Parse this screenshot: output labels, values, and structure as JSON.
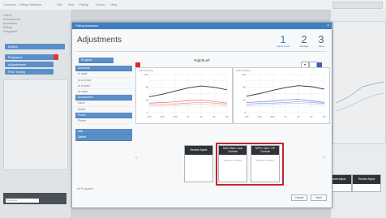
{
  "app": {
    "title": "Connexx - Fitting Software",
    "menu": [
      "File",
      "Edit",
      "Fitting",
      "Extras",
      "Help"
    ],
    "left_list": [
      "Client",
      "Instruments",
      "Acoustics",
      "Fitting",
      "Programs"
    ],
    "left_buttons": [
      "Detect",
      "Programs",
      "Adjustments",
      "Fine Tuning"
    ],
    "bottom_field": "Programs",
    "right_tiles": [
      "Remote Adjust",
      "Remote Adjust"
    ]
  },
  "dialog": {
    "title_bar": "Fitting Assistant",
    "heading": "Adjustments",
    "steps": [
      {
        "num": "1",
        "label": "Adjustments"
      },
      {
        "num": "2",
        "label": "Manage"
      },
      {
        "num": "3",
        "label": "Save"
      }
    ],
    "nav": {
      "top_button": "Program",
      "groups": [
        {
          "header": "Universal",
          "items": [
            "In quiet",
            "In a crowd",
            "In a band",
            "In noise"
          ]
        },
        {
          "header": "Accessories",
          "items": [
            "Hand",
            "Music"
          ]
        },
        {
          "header": "Phone",
          "items": [
            "Phone"
          ]
        },
        {
          "header": "Add",
          "items": []
        },
        {
          "header": "Delete",
          "items": []
        }
      ],
      "footer": "All Programs"
    },
    "chart_heading": "Right/Left",
    "charts": [
      {
        "label": "Gain Hearing",
        "side_color": "#d0302f"
      },
      {
        "label": "Gain Hearing",
        "side_color": "#3f5fbf"
      }
    ],
    "chart_data": [
      {
        "type": "line",
        "title": "",
        "x": [
          "125",
          "250",
          "500",
          "1k",
          "2k",
          "4k",
          "8k"
        ],
        "ylim": [
          0,
          120
        ],
        "series": [
          {
            "values": [
              50,
              58,
              68,
              78,
              84,
              80,
              72
            ]
          },
          {
            "values": [
              30,
              32,
              34,
              38,
              40,
              35,
              30
            ]
          },
          {
            "values": [
              25,
              27,
              28,
              30,
              33,
              30,
              27
            ]
          },
          {
            "values": [
              20,
              22,
              24,
              26,
              28,
              25,
              22
            ]
          }
        ]
      },
      {
        "type": "line",
        "title": "",
        "x": [
          "125",
          "250",
          "500",
          "1k",
          "2k",
          "4k",
          "8k"
        ],
        "ylim": [
          0,
          120
        ],
        "series": [
          {
            "values": [
              52,
              60,
              70,
              79,
              85,
              82,
              74
            ]
          },
          {
            "values": [
              32,
              34,
              36,
              40,
              42,
              37,
              32
            ]
          },
          {
            "values": [
              27,
              29,
              30,
              32,
              35,
              32,
              29
            ]
          },
          {
            "values": [
              22,
              24,
              26,
              28,
              30,
              27,
              24
            ]
          }
        ]
      }
    ],
    "tiles": [
      {
        "caption": "Remote Adjust",
        "body": ""
      },
      {
        "caption": "Soft / Med / Loud Controls",
        "body": "Maximum Values"
      },
      {
        "caption": "MPO / Gain / CR Controls",
        "body": "Maximum Values"
      }
    ],
    "buttons": {
      "back": "Cancel",
      "next": "Next"
    }
  }
}
